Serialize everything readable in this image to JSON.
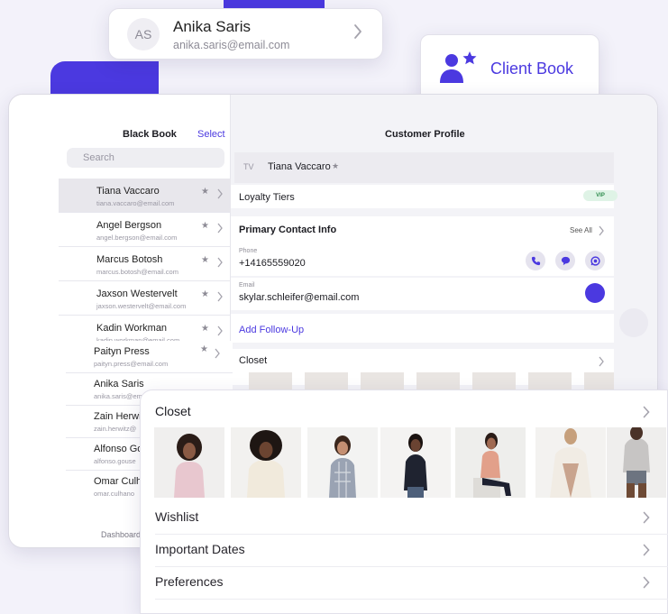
{
  "user_card": {
    "initials": "AS",
    "name": "Anika Saris",
    "email": "anika.saris@email.com"
  },
  "client_book": {
    "label": "Client Book"
  },
  "left_pane": {
    "title": "Black Book",
    "select": "Select",
    "search_placeholder": "Search",
    "contacts": [
      {
        "name": "Tiana Vaccaro",
        "email": "tiana.vaccaro@email.com"
      },
      {
        "name": "Angel Bergson",
        "email": "angel.bergson@email.com"
      },
      {
        "name": "Marcus Botosh",
        "email": "marcus.botosh@email.com"
      },
      {
        "name": "Jaxson Westervelt",
        "email": "jaxson.westervelt@email.com"
      },
      {
        "name": "Kadin Workman",
        "email": "kadin.workman@email.com"
      }
    ],
    "contacts_lower": [
      {
        "name": "Paityn Press",
        "email": "paityn.press@email.com"
      },
      {
        "name": "Anika Saris",
        "email": "anika.saris@em"
      },
      {
        "name": "Zain Herwit",
        "email": "zain.herwitz@"
      },
      {
        "name": "Alfonso Go",
        "email": "alfonso.gouse"
      },
      {
        "name": "Omar Culha",
        "email": "omar.culhano"
      }
    ],
    "star": "★",
    "dashboard": "Dashboard"
  },
  "right_pane": {
    "title": "Customer Profile",
    "initials": "TV",
    "name": "Tiana Vaccaro",
    "star": "★",
    "loyalty": "Loyalty Tiers",
    "vip": "VIP",
    "primary_contact": "Primary Contact Info",
    "see_all": "See All",
    "phone_label": "Phone",
    "phone": "+14165559020",
    "email_label": "Email",
    "email": "skylar.schleifer@email.com",
    "add_follow_up": "Add Follow-Up",
    "closet": "Closet"
  },
  "closet_card": {
    "title": "Closet",
    "items": [
      "Wishlist",
      "Important Dates",
      "Preferences"
    ]
  },
  "colors": {
    "accent": "#4b39e0",
    "vip_bg": "#dff3e6",
    "vip_text": "#2d8a4c"
  }
}
